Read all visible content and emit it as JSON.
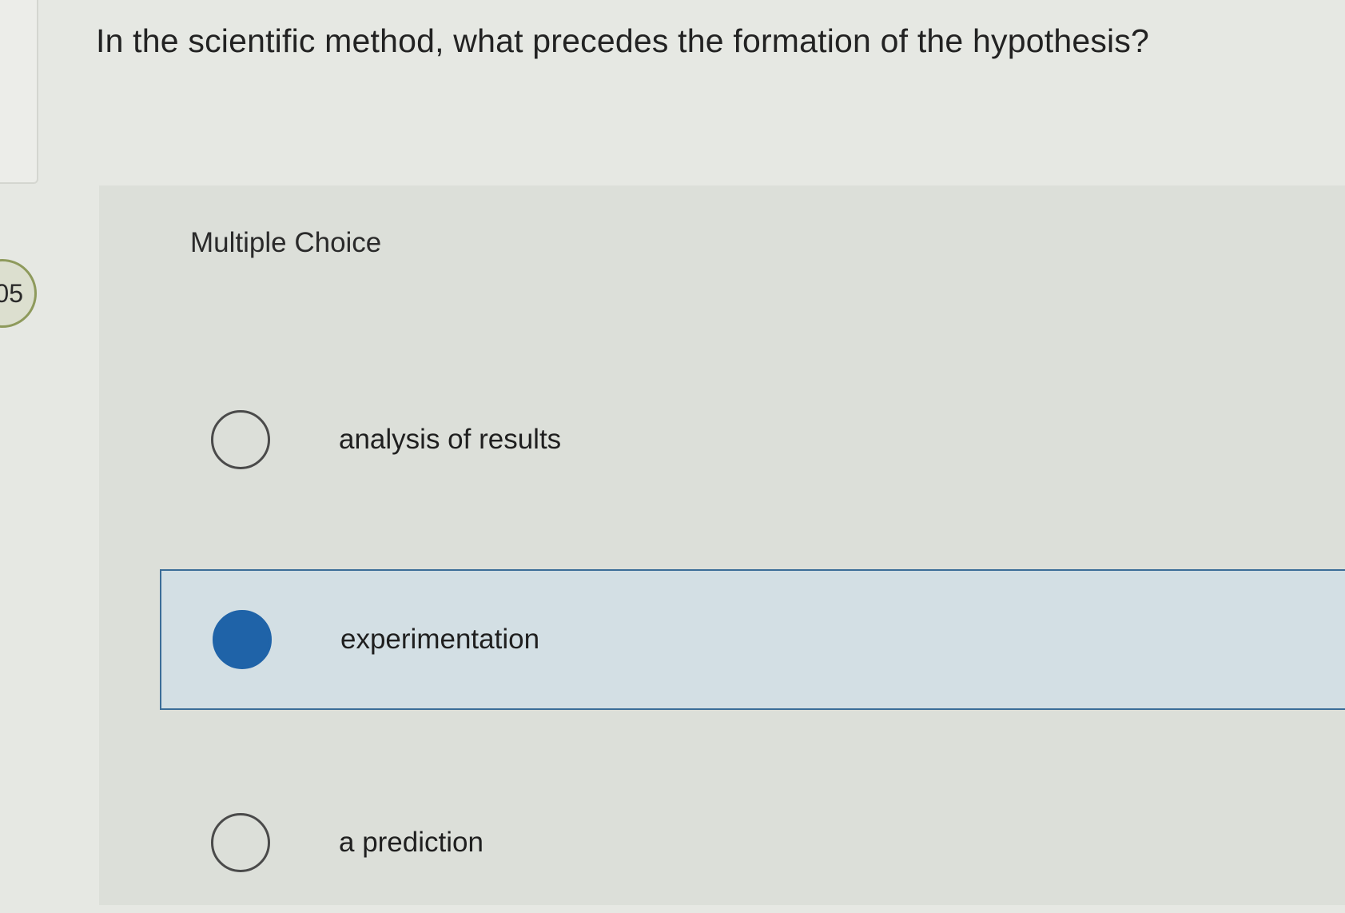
{
  "question": {
    "text": "In the scientific method, what precedes the formation of the hypothesis?"
  },
  "side_badge": {
    "text": "05"
  },
  "answer": {
    "type_label": "Multiple Choice",
    "options": [
      {
        "label": "analysis of results",
        "selected": false
      },
      {
        "label": "experimentation",
        "selected": true
      },
      {
        "label": "a prediction",
        "selected": false
      }
    ]
  },
  "colors": {
    "selected_fill": "#1f63a8",
    "selected_row_bg": "#d3dfe4",
    "selected_row_border": "#3b6d98"
  }
}
